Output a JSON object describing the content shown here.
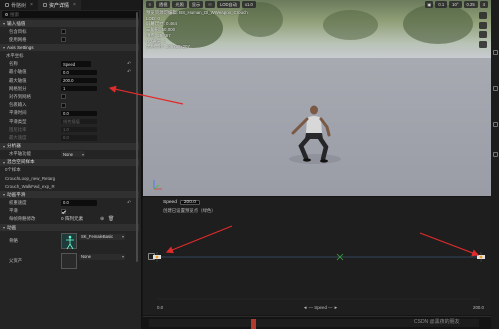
{
  "tabs": [
    {
      "label": "骨骼树",
      "active": false
    },
    {
      "label": "资产详情",
      "active": true
    }
  ],
  "search": {
    "placeholder": "搜索"
  },
  "left_rows": [
    {
      "kind": "sec",
      "label": "输入插值"
    },
    {
      "kind": "check",
      "label": "包含目标",
      "checked": false
    },
    {
      "kind": "check",
      "label": "使用网格",
      "checked": false
    },
    {
      "kind": "sec",
      "label": "Axis Settings"
    },
    {
      "kind": "sub",
      "label": "水平坐标"
    },
    {
      "kind": "val",
      "label": "名称",
      "value": "Speed",
      "w": 30,
      "reset": true
    },
    {
      "kind": "val",
      "label": "最小轴值",
      "value": "0.0",
      "w": 36,
      "reset": true
    },
    {
      "kind": "val",
      "label": "最大轴值",
      "value": "200.0",
      "w": 36
    },
    {
      "kind": "val",
      "label": "网格划分",
      "value": "1",
      "w": 36
    },
    {
      "kind": "check",
      "label": "对齐到网格",
      "checked": false
    },
    {
      "kind": "check",
      "label": "包裹输入",
      "checked": false
    },
    {
      "kind": "val",
      "label": "平滑时间",
      "value": "0.0",
      "w": 36
    },
    {
      "kind": "val",
      "label": "平滑类型",
      "value": "线性插值",
      "w": 36,
      "dim": true
    },
    {
      "kind": "val",
      "label": "阻尼比率",
      "value": "1.0",
      "w": 36,
      "dim": true,
      "dimlabel": true
    },
    {
      "kind": "val",
      "label": "最大速度",
      "value": "0.0",
      "w": 36,
      "dim": true,
      "dimlabel": true
    },
    {
      "kind": "sec",
      "label": "分析器"
    },
    {
      "kind": "dd",
      "label": "水平轴功能",
      "value": "None"
    },
    {
      "kind": "sec",
      "label": "混合空间样本"
    },
    {
      "kind": "tree",
      "label": "0个样本"
    },
    {
      "kind": "tree",
      "label": "CrouchLoop_new_Retarg"
    },
    {
      "kind": "tree",
      "label": "Crouch_WalkFwd_exp_R"
    },
    {
      "kind": "sec",
      "label": "动画平滑"
    },
    {
      "kind": "val",
      "label": "权重速度",
      "value": "0.0",
      "w": 36,
      "reset": true
    },
    {
      "kind": "check",
      "label": "平滑",
      "checked": true
    },
    {
      "kind": "tools",
      "label": "每帧骨骼修改",
      "value": "0 阵列元素"
    },
    {
      "kind": "sec",
      "label": "动画"
    },
    {
      "kind": "asset",
      "label": "骨骼",
      "value": "SK_FemaleBasic"
    },
    {
      "kind": "asset2",
      "label": "父资产",
      "value": "None"
    }
  ],
  "viewport": {
    "toolbar": [
      "透视",
      "光照",
      "显示",
      "LOD自动",
      "x1.0"
    ],
    "stats": [
      "预览资源可编辑: BS_Human_Dl_WWeapon_Crouch",
      "LOD: 0",
      "屏幕尺寸: 0.464",
      "三角形: 50,000",
      "顶点: 25,467",
      "UV通道: 2",
      "大约大小: 206x59x207"
    ],
    "right_badges": [
      "0.1",
      "10°",
      "0.25",
      "4"
    ]
  },
  "blendspace": {
    "param_label": "Speed",
    "param_value": "200.0",
    "hint": "创建已设置预览点（绿色）",
    "axis_min": "0.0",
    "axis_max": "200.0",
    "axis_name": "Speed"
  },
  "watermark": "CSDN @黑夜的朋友"
}
